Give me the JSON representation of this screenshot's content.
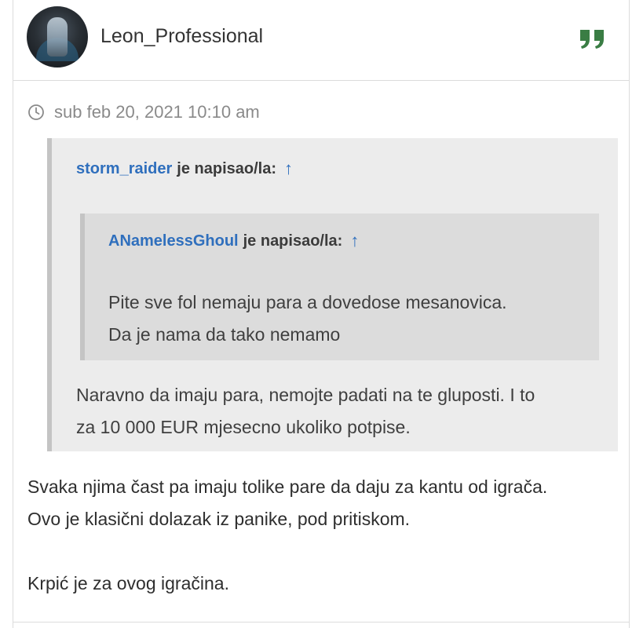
{
  "post": {
    "username": "Leon_Professional",
    "date": "sub feb 20, 2021 10:10 am",
    "icons": {
      "avatar": "user-avatar",
      "quote": "quote-icon",
      "clock": "clock-icon"
    },
    "accent_color": "#2f6fbd",
    "quote_icon_color": "#3a7d44"
  },
  "quote_outer": {
    "author": "storm_raider",
    "suffix": "je napisao/la:",
    "arrow": "↑",
    "text_line1": "Naravno da imaju para, nemojte padati na te gluposti. I to",
    "text_line2": "za 10 000 EUR mjesecno ukoliko potpise."
  },
  "quote_inner": {
    "author": "ANamelessGhoul",
    "suffix": "je napisao/la:",
    "arrow": "↑",
    "text_line1": "Pite sve fol nemaju para a dovedose mesanovica.",
    "text_line2": "Da je nama da tako nemamo"
  },
  "body": {
    "line1": "Svaka njima čast pa imaju tolike pare da daju za kantu od igrača.",
    "line2": "Ovo je klasični dolazak iz panike, pod pritiskom.",
    "line3": "Krpić je za ovog igračina."
  }
}
